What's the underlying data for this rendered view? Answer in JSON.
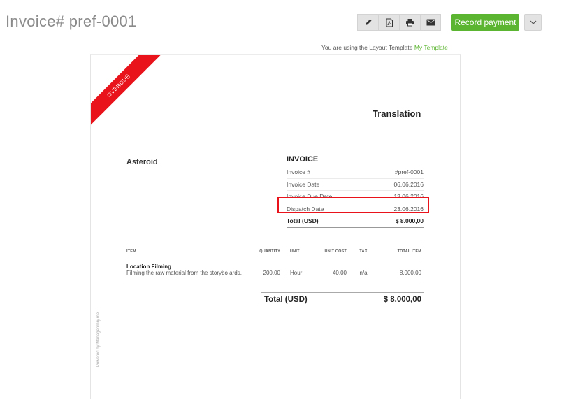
{
  "header": {
    "title": "Invoice# pref-0001",
    "record_payment": "Record payment",
    "toolbar_icons": [
      "pencil-icon",
      "pdf-icon",
      "printer-icon",
      "envelope-icon"
    ],
    "accent": "#5bb531"
  },
  "template_note": {
    "prefix": "You are using the Layout Template",
    "link": "My Template"
  },
  "invoice": {
    "ribbon": "OVERDUE",
    "ribbon_color": "#e8131b",
    "company": "Translation",
    "client": "Asteroid",
    "heading": "INVOICE",
    "rows": [
      {
        "label": "Invoice #",
        "value": "#pref-0001"
      },
      {
        "label": "Invoice Date",
        "value": "06.06.2016"
      },
      {
        "label": "Invoice Due Date",
        "value": "13.06.2016"
      },
      {
        "label": "Dispatch Date",
        "value": "23.06.2016"
      }
    ],
    "total_label": "Total (USD)",
    "total_value": "$ 8.000,00",
    "powered_by": "Powered by Manageprnry.me"
  },
  "items": {
    "headers": {
      "item": "ITEM",
      "quantity": "QUANTITY",
      "unit": "UNIT",
      "unit_cost": "UNIT COST",
      "tax": "TAX",
      "total": "TOTAL ITEM"
    },
    "rows": [
      {
        "title": "Location Filming",
        "description": "Filming the raw material from the storybo ards.",
        "quantity": "200,00",
        "unit": "Hour",
        "unit_cost": "40,00",
        "tax": "n/a",
        "total": "8.000,00"
      }
    ],
    "grand_label": "Total (USD)",
    "grand_value": "$ 8.000,00"
  }
}
